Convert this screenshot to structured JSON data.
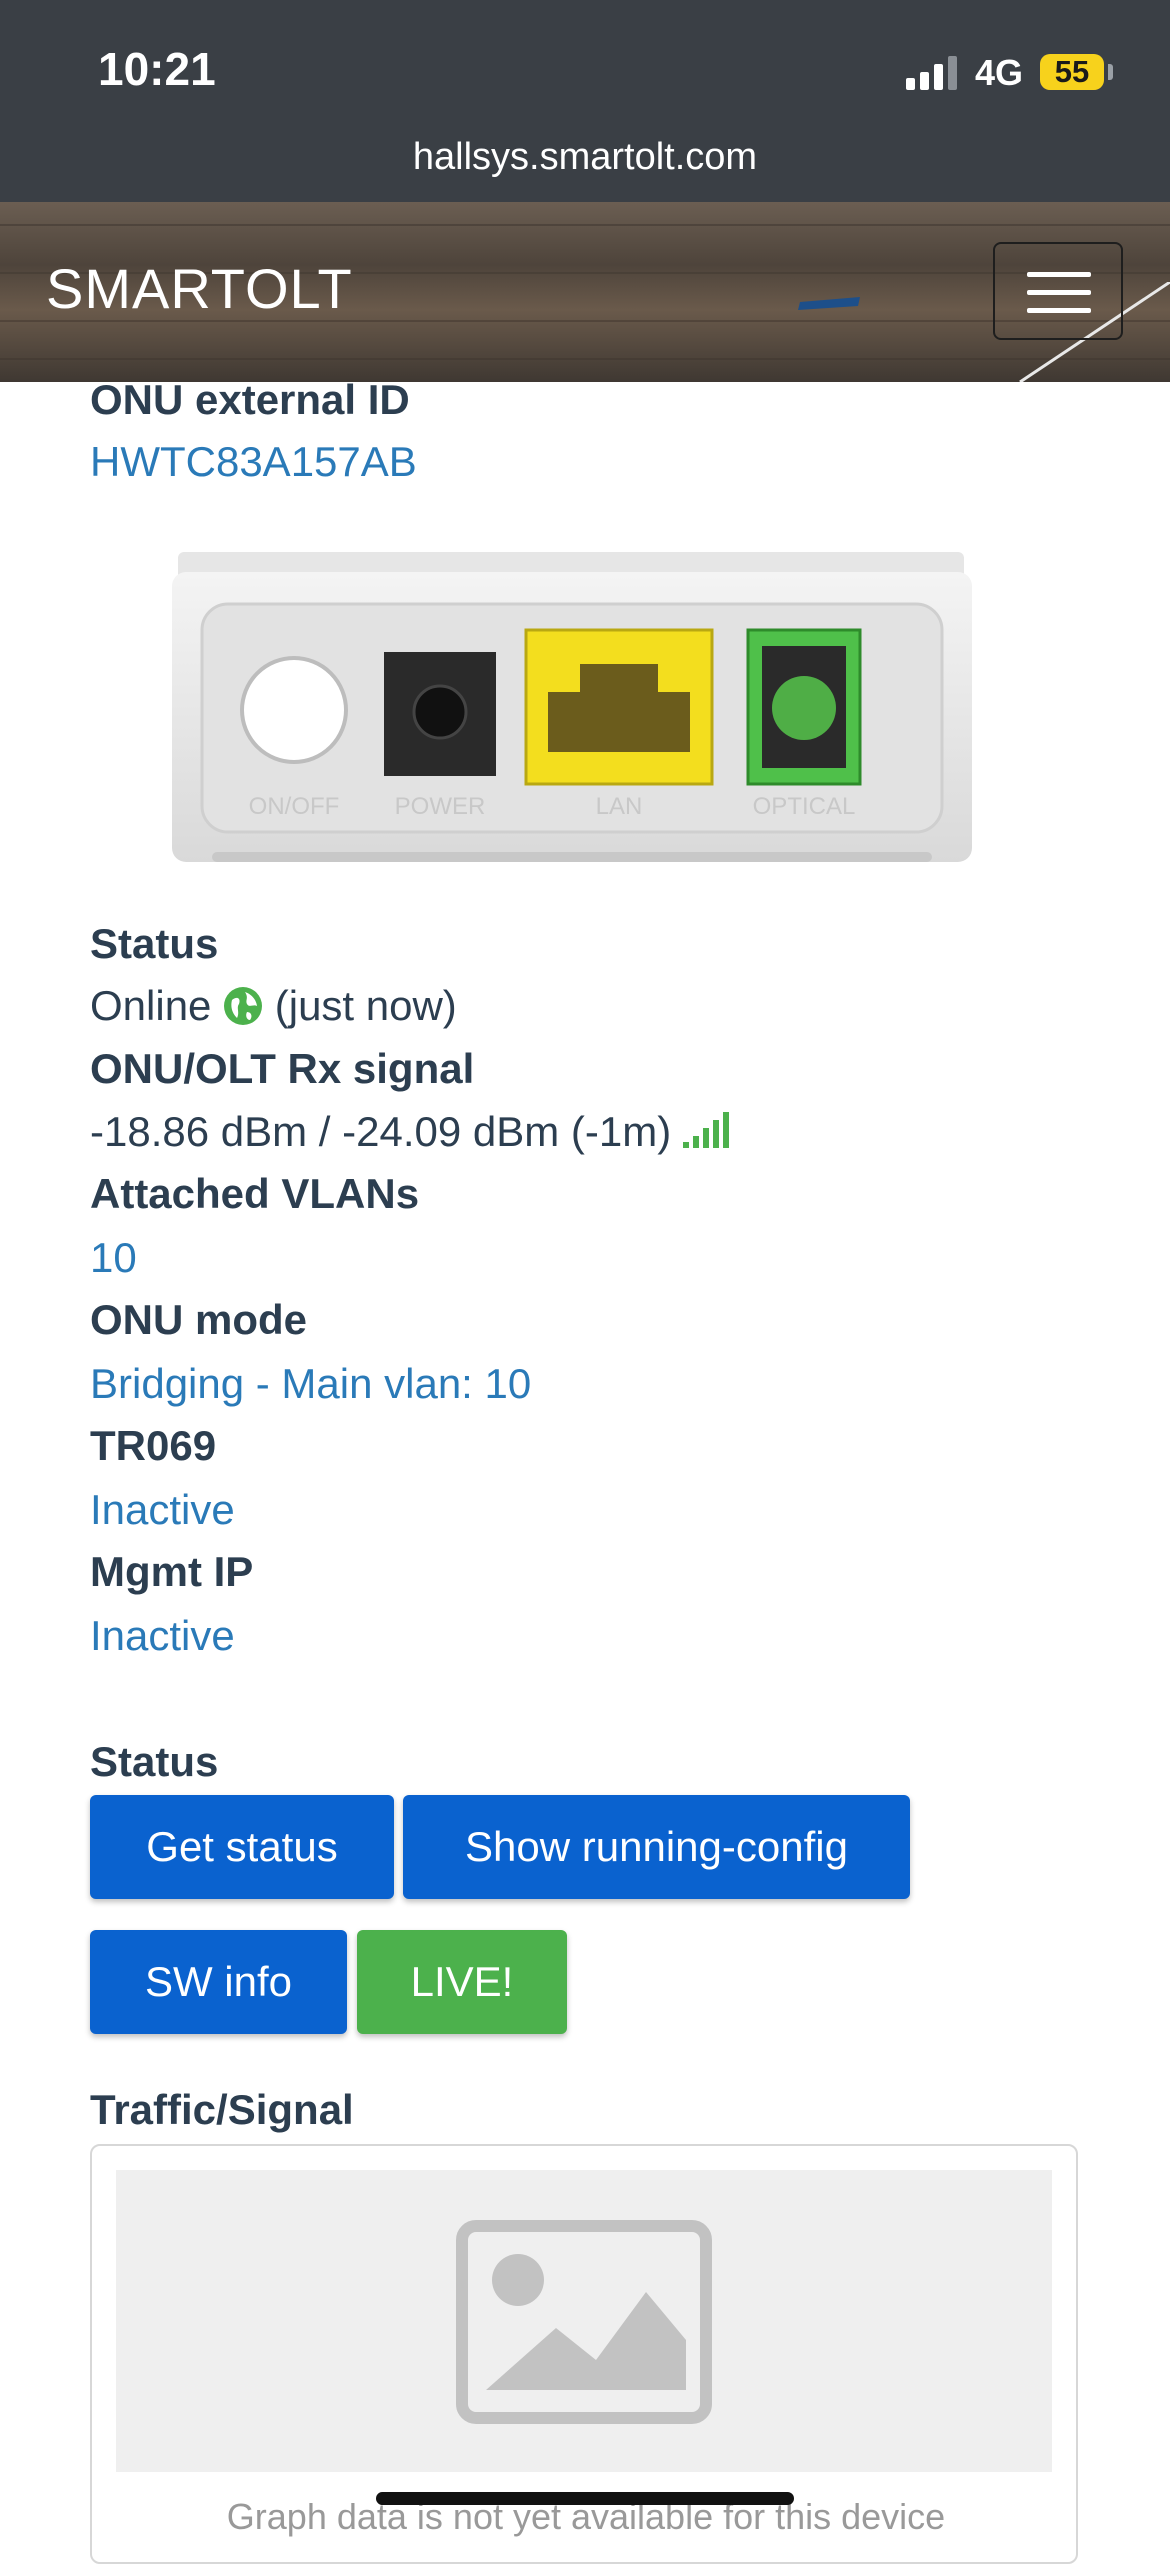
{
  "status_bar": {
    "time": "10:21",
    "network": "4G",
    "battery": "55"
  },
  "browser": {
    "url": "hallsys.smartolt.com"
  },
  "navbar": {
    "brand": "SMARTOLT"
  },
  "onu": {
    "external_id_label": "ONU external ID",
    "external_id_value": "HWTC83A157AB",
    "device_ports": [
      "ON/OFF",
      "POWER",
      "LAN",
      "OPTICAL"
    ],
    "status_label": "Status",
    "status_value": "Online",
    "status_time": "(just now)",
    "signal_label": "ONU/OLT Rx signal",
    "signal_value": "-18.86 dBm / -24.09 dBm (-1m)",
    "vlans_label": "Attached VLANs",
    "vlans_value": "10",
    "mode_label": "ONU mode",
    "mode_value": "Bridging - Main vlan: 10",
    "tr069_label": "TR069",
    "tr069_value": "Inactive",
    "mgmt_label": "Mgmt IP",
    "mgmt_value": "Inactive"
  },
  "actions": {
    "section_label": "Status",
    "get_status": "Get status",
    "show_running_config": "Show running-config",
    "sw_info": "SW info",
    "live": "LIVE!"
  },
  "traffic": {
    "label": "Traffic/Signal",
    "note": "Graph data is not yet available for this device"
  },
  "colors": {
    "primary": "#0a62cf",
    "success": "#4cb14c",
    "link": "#2a7ab8",
    "text": "#2c3e50"
  }
}
